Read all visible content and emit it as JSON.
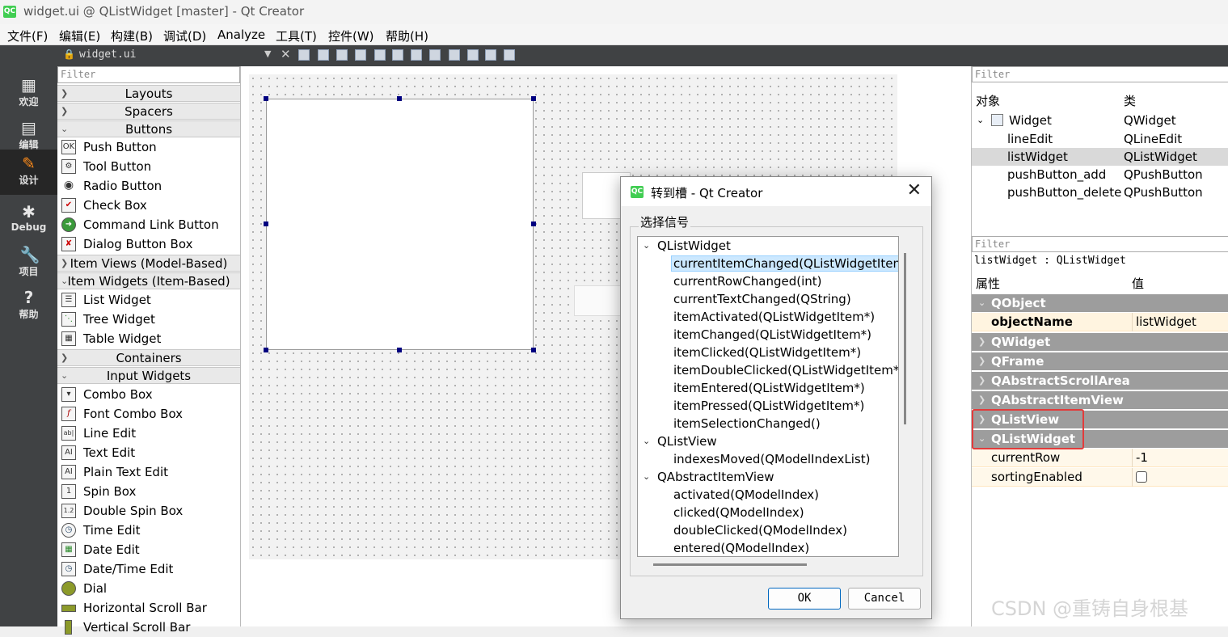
{
  "window": {
    "title": "widget.ui @ QListWidget [master] - Qt Creator",
    "app_icon": "QC"
  },
  "menu": [
    "文件(F)",
    "编辑(E)",
    "构建(B)",
    "调试(D)",
    "Analyze",
    "工具(T)",
    "控件(W)",
    "帮助(H)"
  ],
  "modes": [
    {
      "label": "欢迎",
      "icon": "grid-icon"
    },
    {
      "label": "编辑",
      "icon": "document-icon"
    },
    {
      "label": "设计",
      "icon": "pencil-icon",
      "active": true
    },
    {
      "label": "Debug",
      "icon": "bug-icon"
    },
    {
      "label": "项目",
      "icon": "wrench-icon"
    },
    {
      "label": "帮助",
      "icon": "help-icon"
    }
  ],
  "toolbar": {
    "file": "widget.ui"
  },
  "widgetbox": {
    "filter_placeholder": "Filter",
    "categories": {
      "layouts": "Layouts",
      "spacers": "Spacers",
      "buttons": "Buttons",
      "item_views": "Item Views (Model-Based)",
      "item_widgets": "Item Widgets (Item-Based)",
      "containers": "Containers",
      "input_widgets": "Input Widgets"
    },
    "buttons": [
      "Push Button",
      "Tool Button",
      "Radio Button",
      "Check Box",
      "Command Link Button",
      "Dialog Button Box"
    ],
    "item_widgets": [
      "List Widget",
      "Tree Widget",
      "Table Widget"
    ],
    "input_widgets": [
      "Combo Box",
      "Font Combo Box",
      "Line Edit",
      "Text Edit",
      "Plain Text Edit",
      "Spin Box",
      "Double Spin Box",
      "Time Edit",
      "Date Edit",
      "Date/Time Edit",
      "Dial",
      "Horizontal Scroll Bar",
      "Vertical Scroll Bar"
    ]
  },
  "dialog": {
    "title": "转到槽 - Qt Creator",
    "group_label": "选择信号",
    "ok": "OK",
    "cancel": "Cancel",
    "groups": [
      {
        "name": "QListWidget",
        "signals": [
          "currentItemChanged(QListWidgetItem",
          "currentRowChanged(int)",
          "currentTextChanged(QString)",
          "itemActivated(QListWidgetItem*)",
          "itemChanged(QListWidgetItem*)",
          "itemClicked(QListWidgetItem*)",
          "itemDoubleClicked(QListWidgetItem*)",
          "itemEntered(QListWidgetItem*)",
          "itemPressed(QListWidgetItem*)",
          "itemSelectionChanged()"
        ]
      },
      {
        "name": "QListView",
        "signals": [
          "indexesMoved(QModelIndexList)"
        ]
      },
      {
        "name": "QAbstractItemView",
        "signals": [
          "activated(QModelIndex)",
          "clicked(QModelIndex)",
          "doubleClicked(QModelIndex)",
          "entered(QModelIndex)"
        ]
      }
    ]
  },
  "objects": {
    "filter_placeholder": "Filter",
    "col_object": "对象",
    "col_class": "类",
    "rows": [
      {
        "name": "Widget",
        "cls": "QWidget"
      },
      {
        "name": "lineEdit",
        "cls": "QLineEdit"
      },
      {
        "name": "listWidget",
        "cls": "QListWidget"
      },
      {
        "name": "pushButton_add",
        "cls": "QPushButton"
      },
      {
        "name": "pushButton_delete",
        "cls": "QPushButton"
      }
    ]
  },
  "properties": {
    "filter_placeholder": "Filter",
    "context": "listWidget : QListWidget",
    "col_prop": "属性",
    "col_val": "值",
    "groups": [
      "QObject",
      "QWidget",
      "QFrame",
      "QAbstractScrollArea",
      "QAbstractItemView",
      "QListView",
      "QListWidget"
    ],
    "objectName": {
      "name": "objectName",
      "value": "listWidget"
    },
    "currentRow": {
      "name": "currentRow",
      "value": "-1"
    },
    "sortingEnabled": {
      "name": "sortingEnabled"
    }
  },
  "watermark": "CSDN @重铸自身根基",
  "colors": {
    "accent": "#ff8c1a",
    "highlight_box": "#e23b3b",
    "selection": "#cce8ff"
  }
}
